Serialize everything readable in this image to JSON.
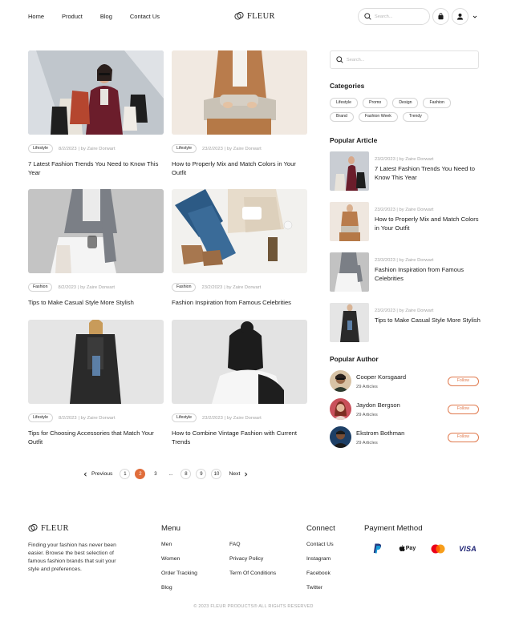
{
  "header": {
    "nav": [
      "Home",
      "Product",
      "Blog",
      "Contact Us"
    ],
    "logo": "FLEUR",
    "search_placeholder": "Search..."
  },
  "posts": [
    {
      "tag": "Lifestyle",
      "date": "8/2/2023",
      "author": "| by Zaire Dorwart",
      "title": "7 Latest Fashion Trends You Need to Know This Year"
    },
    {
      "tag": "Lifestyle",
      "date": "23/2/2023",
      "author": "| by Zaire Dorwart",
      "title": "How to Properly Mix and Match Colors in Your Outfit"
    },
    {
      "tag": "Fashion",
      "date": "8/2/2023",
      "author": "| by Zaire Dorwart",
      "title": "Tips to Make Casual Style More Stylish"
    },
    {
      "tag": "Fashion",
      "date": "23/2/2023",
      "author": "| by Zaire Dorwart",
      "title": "Fashion Inspiration from Famous Celebrities"
    },
    {
      "tag": "Lifestyle",
      "date": "8/2/2023",
      "author": "| by Zaire Dorwart",
      "title": "Tips for Choosing Accessories that Match Your Outfit"
    },
    {
      "tag": "Lifestyle",
      "date": "23/2/2023",
      "author": "| by Zaire Dorwart",
      "title": "How to Combine Vintage Fashion with Current Trends"
    }
  ],
  "pagination": {
    "previous": "Previous",
    "next": "Next",
    "pages": [
      "1",
      "2",
      "3",
      "...",
      "8",
      "9",
      "10"
    ],
    "current": "2"
  },
  "sidebar": {
    "search_placeholder": "Search...",
    "categories_title": "Categories",
    "categories": [
      "Lifestyle",
      "Promo",
      "Design",
      "Fashion",
      "Brand",
      "Fashion Week",
      "Trendy"
    ],
    "popular_article_title": "Popular Article",
    "popular_articles": [
      {
        "date": "23/2/2023 | by Zaire Dorwart",
        "title": "7 Latest Fashion Trends You Need to Know This Year"
      },
      {
        "date": "23/2/2023 | by Zaire Dorwart",
        "title": "How to Properly Mix and Match Colors in Your Outfit"
      },
      {
        "date": "23/3/2023 | by Zaire Dorwart",
        "title": "Fashion Inspiration from Famous Celebrities"
      },
      {
        "date": "23/2/2023 | by Zaire Dorwart",
        "title": "Tips to Make Casual Style More Stylish"
      }
    ],
    "popular_author_title": "Popular Author",
    "authors": [
      {
        "name": "Cooper Korsgaard",
        "count": "29 Articles",
        "follow": "Follow"
      },
      {
        "name": "Jaydon Bergson",
        "count": "29 Articles",
        "follow": "Follow"
      },
      {
        "name": "Ekstrom Bothman",
        "count": "29 Articles",
        "follow": "Follow"
      }
    ]
  },
  "footer": {
    "logo": "FLEUR",
    "description": "Finding your fashion has never been easier. Browse the best selection of famous fashion brands that suit your style and preferences.",
    "menu_title": "Menu",
    "menu_col1": [
      "Men",
      "Women",
      "Order Tracking",
      "Blog"
    ],
    "menu_col2": [
      "FAQ",
      "Privacy Policy",
      "Term Of Conditions"
    ],
    "connect_title": "Connect",
    "connect": [
      "Contact Us",
      "Instagram",
      "Facebook",
      "Twitter"
    ],
    "payment_title": "Payment Method",
    "payment_icons": [
      "paypal-icon",
      "apple-pay-icon",
      "mastercard-icon",
      "visa-icon"
    ],
    "apple_pay_label": "Pay",
    "visa_label": "VISA",
    "copyright": "© 2023 FLEUR PRODUCTS® ALL RIGHTS RESERVED"
  },
  "colors": {
    "accent": "#e06d3b",
    "follow": "#e07a4e"
  }
}
